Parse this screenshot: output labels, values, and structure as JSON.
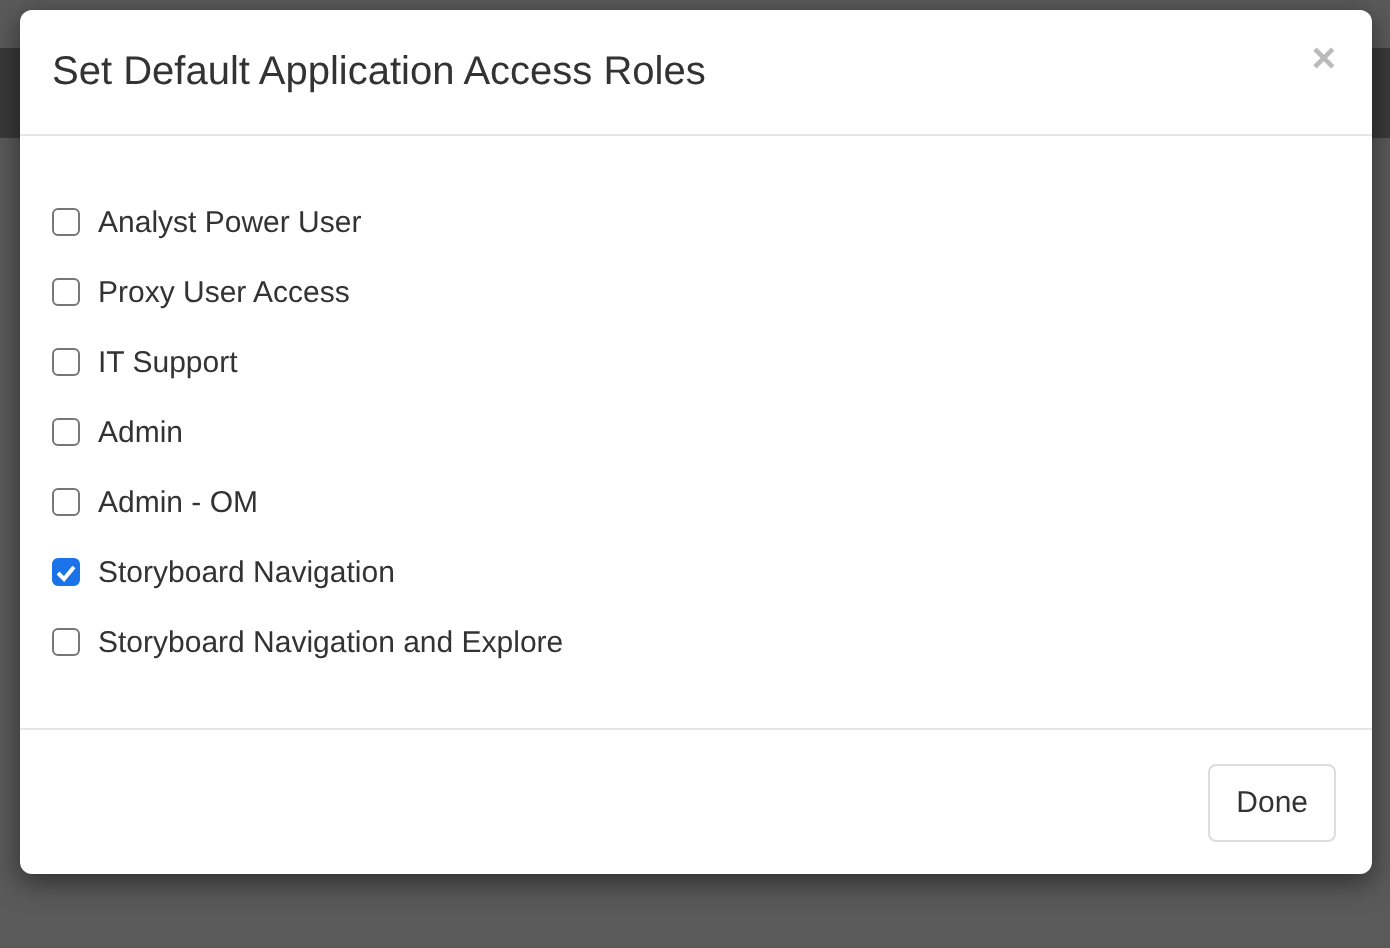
{
  "dialog": {
    "title": "Set Default Application Access Roles",
    "close": "×",
    "roles": [
      {
        "label": "Analyst Power User",
        "checked": false
      },
      {
        "label": "Proxy User Access",
        "checked": false
      },
      {
        "label": "IT Support",
        "checked": false
      },
      {
        "label": "Admin",
        "checked": false
      },
      {
        "label": "Admin - OM",
        "checked": false
      },
      {
        "label": "Storyboard Navigation",
        "checked": true
      },
      {
        "label": "Storyboard Navigation and Explore",
        "checked": false
      }
    ],
    "buttons": [
      "Done"
    ]
  }
}
